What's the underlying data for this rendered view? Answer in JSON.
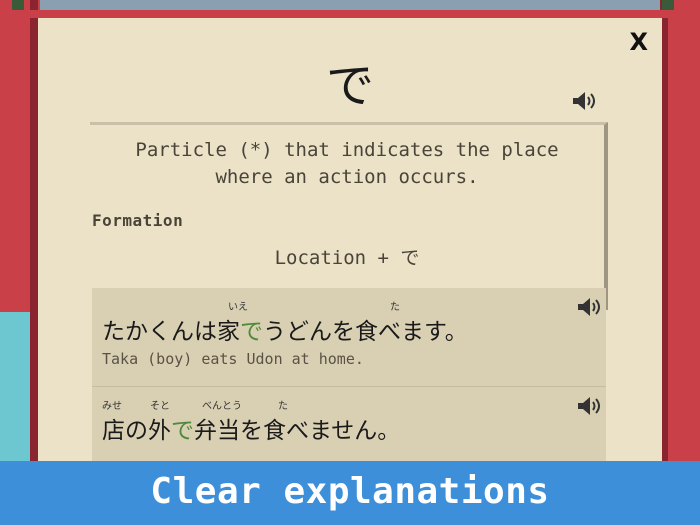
{
  "lesson": {
    "title": "で",
    "description": "Particle (*) that indicates the place where an action occurs.",
    "formation_label": "Formation",
    "formation_value": "Location + で",
    "close_label": "X"
  },
  "examples": [
    {
      "jp_before": "たかくんは家",
      "jp_particle": "で",
      "jp_after": "うどんを食べます。",
      "ruby": [
        "いえ",
        "た"
      ],
      "translation": "Taka (boy) eats Udon at home."
    },
    {
      "jp_before": "店の外",
      "jp_particle": "で",
      "jp_after": "弁当を食べません。",
      "ruby": [
        "みせ",
        "そと",
        "べんとう",
        "た"
      ]
    }
  ],
  "caption": "Clear explanations",
  "icons": [
    "speaker-icon",
    "close-icon"
  ],
  "colors": {
    "card_bg": "#ebe2c8",
    "highlight": "#4f8a3a",
    "caption_bg": "#3d8fd9",
    "pillar": "#c94048"
  }
}
